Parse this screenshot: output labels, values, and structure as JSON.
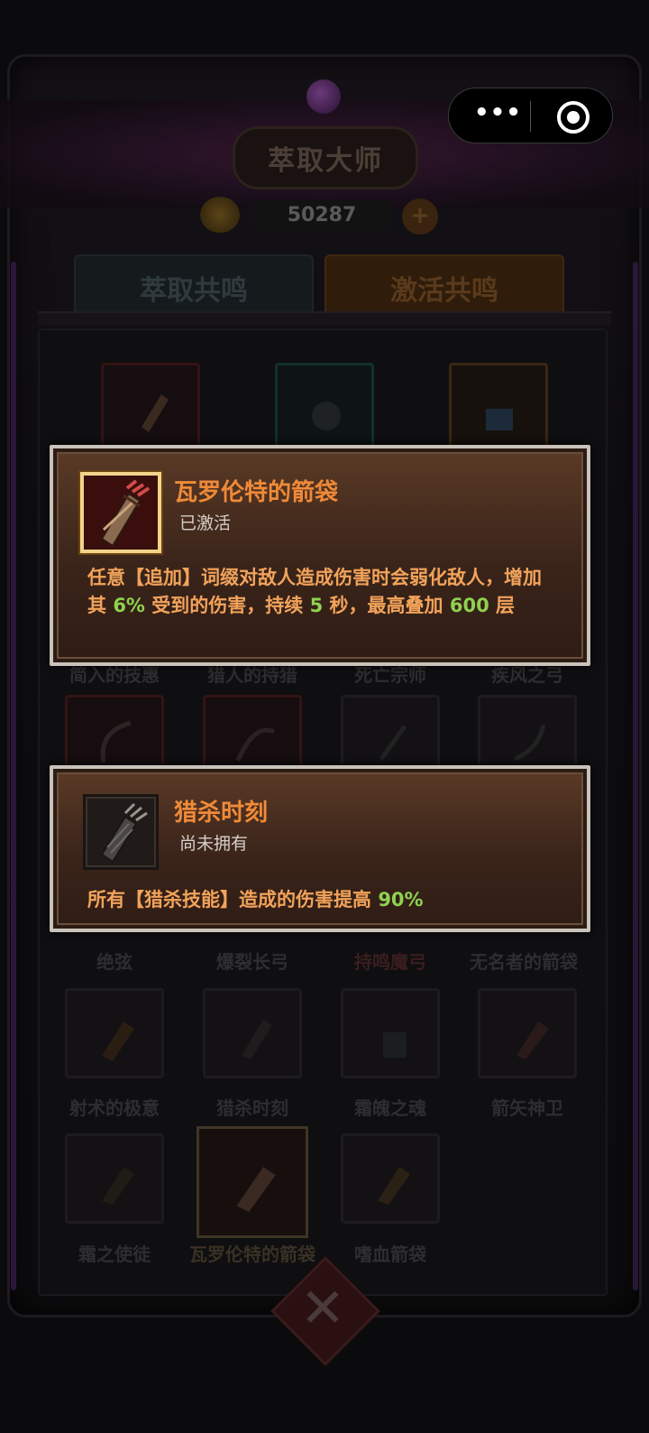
{
  "header": {
    "title": "萃取大师",
    "coin_count": "50287",
    "plus_label": "+"
  },
  "capsule": {
    "more_label": "•••"
  },
  "tabs": [
    {
      "label": "萃取共鸣"
    },
    {
      "label": "激活共鸣"
    }
  ],
  "grid": {
    "rows": [
      {
        "labels": [
          "",
          "",
          ""
        ]
      },
      {
        "labels": [
          "简入的技惠",
          "猎人的持猎",
          "死亡宗师",
          "疾风之弓"
        ]
      },
      {
        "labels": [
          "绝弦",
          "爆裂长弓",
          "持鸣魔弓",
          "无名者的箭袋"
        ]
      },
      {
        "labels": [
          "射术的极意",
          "猎杀时刻",
          "霜魄之魂",
          "箭矢神卫"
        ]
      },
      {
        "labels": [
          "霜之使徒",
          "瓦罗伦特的箭袋",
          "嗜血箭袋"
        ]
      }
    ]
  },
  "popup1": {
    "name": "瓦罗伦特的箭袋",
    "status": "已激活",
    "desc": {
      "a": "任意【追加】词缀对敌人造成伤害时会弱化敌人，增加其 ",
      "v1": "6%",
      "b": " 受到的伤害，持续 ",
      "v2": "5",
      "c": " 秒，最高叠加 ",
      "v3": "600",
      "d": " 层"
    }
  },
  "popup2": {
    "name": "猎杀时刻",
    "status": "尚未拥有",
    "desc": {
      "a": "所有【猎杀技能】造成的伤害提高 ",
      "v1": "90%"
    }
  },
  "icons": {
    "quiver": "quiver-icon",
    "arrows": "arrow-bundle-icon",
    "coin": "gold-coin-icon",
    "close": "close-x-icon"
  }
}
